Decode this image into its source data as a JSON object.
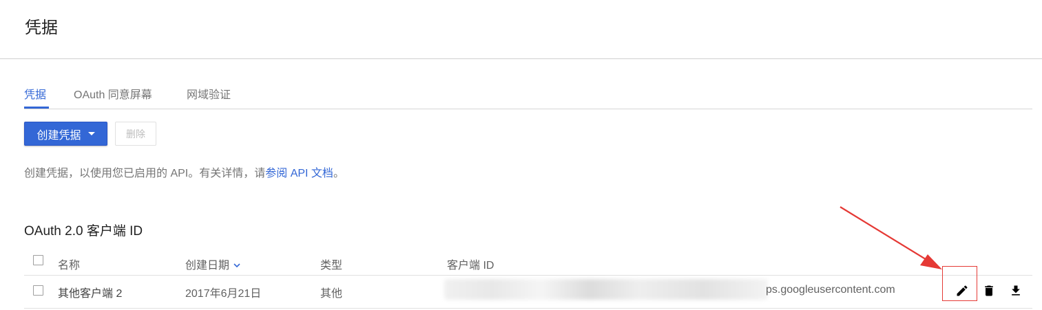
{
  "page": {
    "title": "凭据"
  },
  "tabs": [
    {
      "label": "凭据",
      "active": true
    },
    {
      "label": "OAuth 同意屏幕",
      "active": false
    },
    {
      "label": "网域验证",
      "active": false
    }
  ],
  "toolbar": {
    "create_label": "创建凭据",
    "delete_label": "删除"
  },
  "help": {
    "text_before": "创建凭据，以使用您已启用的 API。有关详情，请",
    "link_text": "参阅 API 文档",
    "text_after": "。"
  },
  "section": {
    "title": "OAuth 2.0 客户端 ID"
  },
  "table": {
    "headers": {
      "name": "名称",
      "created": "创建日期",
      "type": "类型",
      "client_id": "客户端 ID"
    },
    "rows": [
      {
        "name": "其他客户端 2",
        "created": "2017年6月21日",
        "type": "其他",
        "client_id_visible": "ps.googleusercontent.com"
      }
    ]
  },
  "icons": {
    "edit": "pencil-icon",
    "delete": "trash-icon",
    "download": "download-icon",
    "sort": "chevron-down-icon"
  },
  "colors": {
    "accent": "#3367d6",
    "annotation": "#e53935",
    "muted_text": "#757575"
  }
}
